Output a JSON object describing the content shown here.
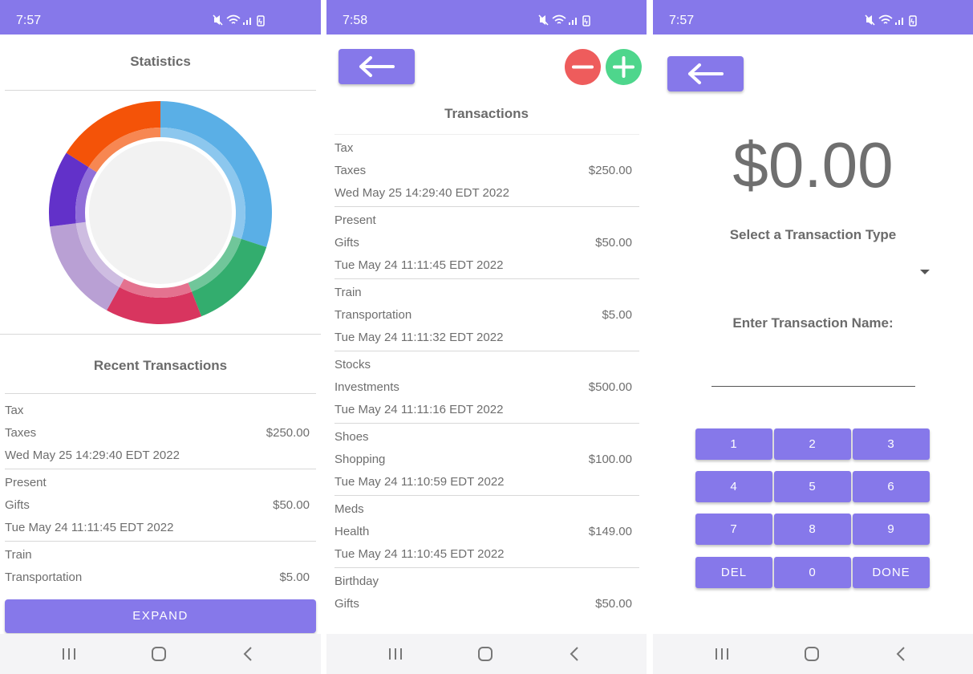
{
  "colors": {
    "accent": "#8678ea",
    "text": "#6e6e6e",
    "minus": "#ee5c5c",
    "plus": "#4ed68c"
  },
  "stats_screen": {
    "time": "7:57",
    "title": "Statistics",
    "chart_data": {
      "type": "pie",
      "slices": [
        {
          "color": "#5aafe6",
          "value": 30
        },
        {
          "color": "#33ad6e",
          "value": 14
        },
        {
          "color": "#d8355f",
          "value": 14
        },
        {
          "color": "#b9a0d4",
          "value": 15
        },
        {
          "color": "#6231c9",
          "value": 11
        },
        {
          "color": "#f45308",
          "value": 16
        }
      ]
    },
    "recent_title": "Recent Transactions",
    "transactions": [
      {
        "name": "Tax",
        "category": "Taxes",
        "amount": "$250.00",
        "date": "Wed May 25 14:29:40 EDT 2022"
      },
      {
        "name": "Present",
        "category": "Gifts",
        "amount": "$50.00",
        "date": "Tue May 24 11:11:45 EDT 2022"
      },
      {
        "name": "Train",
        "category": "Transportation",
        "amount": "$5.00"
      }
    ],
    "expand_label": "EXPAND"
  },
  "list_screen": {
    "time": "7:58",
    "title": "Transactions",
    "transactions": [
      {
        "name": "Tax",
        "category": "Taxes",
        "amount": "$250.00",
        "date": "Wed May 25 14:29:40 EDT 2022"
      },
      {
        "name": "Present",
        "category": "Gifts",
        "amount": "$50.00",
        "date": "Tue May 24 11:11:45 EDT 2022"
      },
      {
        "name": "Train",
        "category": "Transportation",
        "amount": "$5.00",
        "date": "Tue May 24 11:11:32 EDT 2022"
      },
      {
        "name": "Stocks",
        "category": "Investments",
        "amount": "$500.00",
        "date": "Tue May 24 11:11:16 EDT 2022"
      },
      {
        "name": "Shoes",
        "category": "Shopping",
        "amount": "$100.00",
        "date": "Tue May 24 11:10:59 EDT 2022"
      },
      {
        "name": "Meds",
        "category": "Health",
        "amount": "$149.00",
        "date": "Tue May 24 11:10:45 EDT 2022"
      },
      {
        "name": "Birthday",
        "category": "Gifts",
        "amount": "$50.00"
      }
    ]
  },
  "entry_screen": {
    "time": "7:57",
    "amount": "$0.00",
    "type_label": "Select a Transaction Type",
    "name_label": "Enter Transaction Name:",
    "keys": [
      "1",
      "2",
      "3",
      "4",
      "5",
      "6",
      "7",
      "8",
      "9",
      "DEL",
      "0",
      "DONE"
    ]
  }
}
